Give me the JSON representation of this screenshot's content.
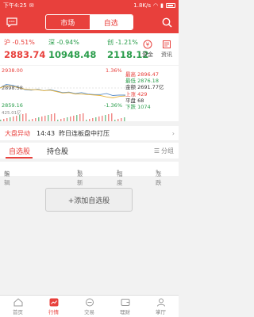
{
  "status": {
    "time": "下午4:25",
    "network": "1.8K/s"
  },
  "topbar": {
    "tabs": [
      "市场",
      "自选"
    ],
    "active_tab": "自选"
  },
  "indices": [
    {
      "name": "沪",
      "change": "-0.51%",
      "value": "2883.74"
    },
    {
      "name": "深",
      "change": "-0.94%",
      "value": "10948.48"
    },
    {
      "name": "创",
      "change": "-1.21%",
      "value": "2118.12"
    }
  ],
  "side_buttons": {
    "funds": "资金",
    "news": "资讯"
  },
  "chart_data": {
    "type": "line",
    "y_max_label": "2938.00",
    "y_mid_label": "2898.58",
    "y_min_label": "2859.16",
    "pct_top": "1.36%",
    "pct_bottom": "-1.36%",
    "volume_label": "425.01亿",
    "ylim": [
      2859.16,
      2938.0
    ],
    "series": [
      {
        "values": [
          2898.58,
          2906,
          2904,
          2900,
          2895,
          2894,
          2896,
          2893,
          2895,
          2892,
          2889,
          2890,
          2887,
          2889,
          2886,
          2885,
          2885,
          2887,
          2883,
          2884,
          2883.74
        ]
      },
      {
        "values": [
          2898.58,
          2903,
          2902,
          2899,
          2896,
          2895,
          2895,
          2893,
          2894,
          2891,
          2888,
          2889,
          2886,
          2886,
          2885,
          2884,
          2883,
          2880,
          2878,
          2881,
          2882
        ]
      }
    ]
  },
  "stats": {
    "high_label": "最高",
    "high": "2896.47",
    "low_label": "最低",
    "low": "2876.18",
    "amount_label": "金额",
    "amount": "2691.77亿",
    "up_label": "上涨",
    "up": "429",
    "flat_label": "平盘",
    "flat": "68",
    "down_label": "下跌",
    "down": "1074"
  },
  "alert": {
    "tag": "大盘异动",
    "time": "14:43",
    "text": "昨日连板盘中打压"
  },
  "tabs": {
    "watchlist": "自选股",
    "holdings": "持仓股",
    "group": "分组"
  },
  "columns": {
    "edit": "编辑",
    "latest": "最新",
    "change_pct": "幅度",
    "change": "涨跌"
  },
  "add_button": "+添加自选股",
  "nav": [
    "首页",
    "行情",
    "交易",
    "理财",
    "掌厅"
  ],
  "colors": {
    "brand": "#e8403c",
    "up": "#e8403c",
    "down": "#2a9d4b"
  }
}
